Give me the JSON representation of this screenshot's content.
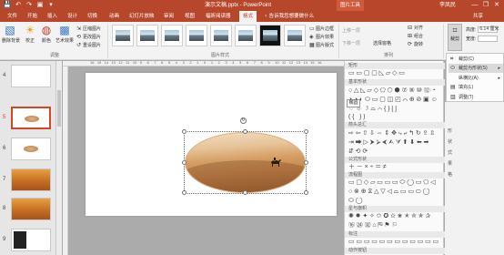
{
  "window": {
    "title": "演示文稿.pptx - PowerPoint",
    "context_tab": "图片工具",
    "user": "李凤民",
    "controls": [
      "—",
      "❐",
      "✕"
    ]
  },
  "quick_access": [
    "💾",
    "↶",
    "↷",
    "▣",
    "▾"
  ],
  "tabs": [
    "文件",
    "开始",
    "插入",
    "设计",
    "切换",
    "动画",
    "幻灯片放映",
    "审阅",
    "视图",
    "福昕阅读器",
    "格式"
  ],
  "active_tab": "格式",
  "tell_me": "♀ 告诉我您想要做什么",
  "share": "共享",
  "ribbon": {
    "adjust": {
      "label": "调整",
      "remove_bg": "删除背景",
      "corrections": "校正",
      "color": "颜色",
      "artistic": "艺术效果",
      "compress": "压缩图片",
      "change": "更改图片",
      "reset": "重设图片"
    },
    "styles": {
      "label": "图片样式",
      "border": "图片边框",
      "effects": "图片效果",
      "layout": "图片版式"
    },
    "arrange": {
      "label": "排列",
      "bring_forward": "上移一层",
      "send_backward": "下移一层",
      "selection_pane": "选择窗格",
      "align": "对齐",
      "group": "组合",
      "rotate": "旋转"
    },
    "size": {
      "crop": "裁剪",
      "height_label": "高度:",
      "height_value": "6.14 厘米",
      "width_label": "宽度:",
      "width_value": ""
    }
  },
  "slides": [
    {
      "num": "4",
      "kind": "blank"
    },
    {
      "num": "5",
      "kind": "ellipse",
      "selected": true
    },
    {
      "num": "6",
      "kind": "ellipse"
    },
    {
      "num": "7",
      "kind": "desert"
    },
    {
      "num": "8",
      "kind": "desert"
    },
    {
      "num": "9",
      "kind": "dark"
    }
  ],
  "ruler_ticks": [
    "16",
    "15",
    "14",
    "13",
    "12",
    "11",
    "10",
    "9",
    "8",
    "7",
    "6",
    "5",
    "4",
    "3",
    "2",
    "1",
    "0",
    "1",
    "2",
    "3",
    "4",
    "5",
    "6",
    "7",
    "8",
    "9",
    "10",
    "11",
    "12",
    "13",
    "14",
    "15",
    "16"
  ],
  "shapes_panel": {
    "recent_header": "矩形",
    "basic_header": "基本形状",
    "arrows_header": "箭头总汇",
    "equation_header": "公式形状",
    "flowchart_header": "流程图",
    "stars_header": "星与旗帜",
    "callouts_header": "标注",
    "action_header": "动作按钮",
    "tooltip": "椭圆",
    "rows": {
      "recent": "▭▭▢▢◺▱◇▭",
      "basic1": "○△◺▱◇⬠⬡⬢⑦⑧⑩⑫◔",
      "basic2": "◕◑◐⬭▭▢◫◰⌒⊕⊘▣☺",
      "basic3": "♡☼☽⌓⌒{}[]",
      "basic4": "({ })",
      "arrows1": "⇨⇦⇧⇩⇔⇕✥⤷⤶↰↻⇪⇫",
      "arrows2": "⇥⮕▷⮞⮚⮜⮙⮛⬆⬇⬅➡",
      "arrows3": "⇵⟲⟳",
      "equation": "＋－×÷＝≠",
      "flow1": "▭▢◇▱▭▭▭⬭◯▭⬠◁",
      "flow2": "○⊗⊕⧖△▽◁⌓▭▭⬭◯",
      "flow3": "⬭◯",
      "stars1": "✺✹✦✧✩✪✫✬✭✮✯✰",
      "stars2": "⑯㉔㉜⌂⛿⚑⚐",
      "callouts": "▭▭▭▭▭▭▭▭▭▭▭▭"
    }
  },
  "crop_menu": {
    "items": [
      {
        "icon": "⌗",
        "label": "裁剪(C)"
      },
      {
        "icon": "⬭",
        "label": "裁剪为形状(S)",
        "highlight": true,
        "submenu": true
      },
      {
        "icon": "",
        "label": "纵横比(A)",
        "submenu": true
      },
      {
        "icon": "▤",
        "label": "填充(L)"
      },
      {
        "icon": "▥",
        "label": "调整(T)"
      }
    ]
  },
  "right_strip_text": [
    "形",
    "状",
    "式",
    "果",
    "格"
  ]
}
